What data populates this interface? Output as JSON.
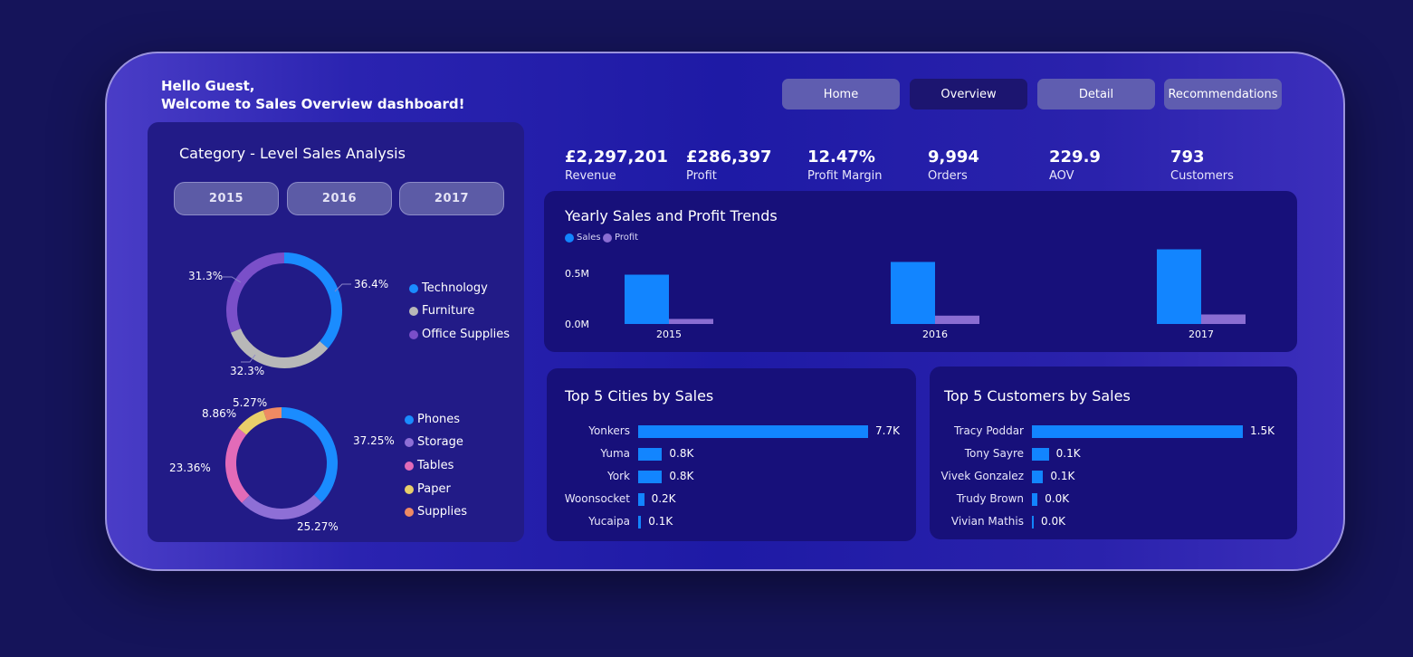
{
  "header": {
    "greeting_line1": "Hello Guest,",
    "greeting_line2": "Welcome to Sales Overview dashboard!"
  },
  "nav": {
    "items": [
      {
        "label": "Home",
        "active": false
      },
      {
        "label": "Overview",
        "active": true
      },
      {
        "label": "Detail",
        "active": false
      },
      {
        "label": "Recommendations",
        "active": false
      }
    ]
  },
  "category_panel": {
    "title": "Category - Level Sales Analysis",
    "years": [
      "2015",
      "2016",
      "2017"
    ],
    "category_donut": {
      "slices": [
        {
          "name": "Technology",
          "value": 36.4,
          "label": "36.4%",
          "color": "#1a8cff"
        },
        {
          "name": "Furniture",
          "value": 32.3,
          "label": "32.3%",
          "color": "#b8b8b8"
        },
        {
          "name": "Office Supplies",
          "value": 31.3,
          "label": "31.3%",
          "color": "#7a4fc9"
        }
      ]
    },
    "subcategory_donut": {
      "slices": [
        {
          "name": "Phones",
          "value": 37.25,
          "label": "37.25%",
          "color": "#1a8cff"
        },
        {
          "name": "Storage",
          "value": 25.27,
          "label": "25.27%",
          "color": "#8e6fd6"
        },
        {
          "name": "Tables",
          "value": 23.36,
          "label": "23.36%",
          "color": "#e26bb8"
        },
        {
          "name": "Paper",
          "value": 8.86,
          "label": "8.86%",
          "color": "#e8cf6a"
        },
        {
          "name": "Supplies",
          "value": 5.27,
          "label": "5.27%",
          "color": "#ef8a63"
        }
      ]
    }
  },
  "kpis": [
    {
      "value": "£2,297,201",
      "label": "Revenue"
    },
    {
      "value": "£286,397",
      "label": "Profit"
    },
    {
      "value": "12.47%",
      "label": "Profit Margin"
    },
    {
      "value": "9,994",
      "label": "Orders"
    },
    {
      "value": "229.9",
      "label": "AOV"
    },
    {
      "value": "793",
      "label": "Customers"
    }
  ],
  "yearly_trends": {
    "title": "Yearly Sales and Profit Trends",
    "legend": [
      {
        "name": "Sales",
        "color": "#1285ff"
      },
      {
        "name": "Profit",
        "color": "#8a6dd2"
      }
    ],
    "y_ticks": [
      "0.5M",
      "0.0M"
    ]
  },
  "top_cities": {
    "title": "Top 5 Cities by Sales",
    "items": [
      {
        "name": "Yonkers",
        "label": "7.7K",
        "value": 7.7
      },
      {
        "name": "Yuma",
        "label": "0.8K",
        "value": 0.8
      },
      {
        "name": "York",
        "label": "0.8K",
        "value": 0.8
      },
      {
        "name": "Woonsocket",
        "label": "0.2K",
        "value": 0.2
      },
      {
        "name": "Yucaipa",
        "label": "0.1K",
        "value": 0.1
      }
    ]
  },
  "top_customers": {
    "title": "Top 5 Customers by Sales",
    "items": [
      {
        "name": "Tracy Poddar",
        "label": "1.5K",
        "value": 1.5
      },
      {
        "name": "Tony Sayre",
        "label": "0.1K",
        "value": 0.12
      },
      {
        "name": "Vivek Gonzalez",
        "label": "0.1K",
        "value": 0.08
      },
      {
        "name": "Trudy Brown",
        "label": "0.0K",
        "value": 0.04
      },
      {
        "name": "Vivian Mathis",
        "label": "0.0K",
        "value": 0.01
      }
    ]
  },
  "chart_data": {
    "type": "bar",
    "title": "Yearly Sales and Profit Trends",
    "categories": [
      "2015",
      "2016",
      "2017"
    ],
    "series": [
      {
        "name": "Sales",
        "values": [
          484247,
          609206,
          733215
        ]
      },
      {
        "name": "Profit",
        "values": [
          49544,
          81795,
          93439
        ]
      }
    ],
    "ylim": [
      0,
      800000
    ],
    "y_ticks": [
      "0.5M",
      "0.0M"
    ],
    "legend_position": "top-left",
    "grid": false
  }
}
